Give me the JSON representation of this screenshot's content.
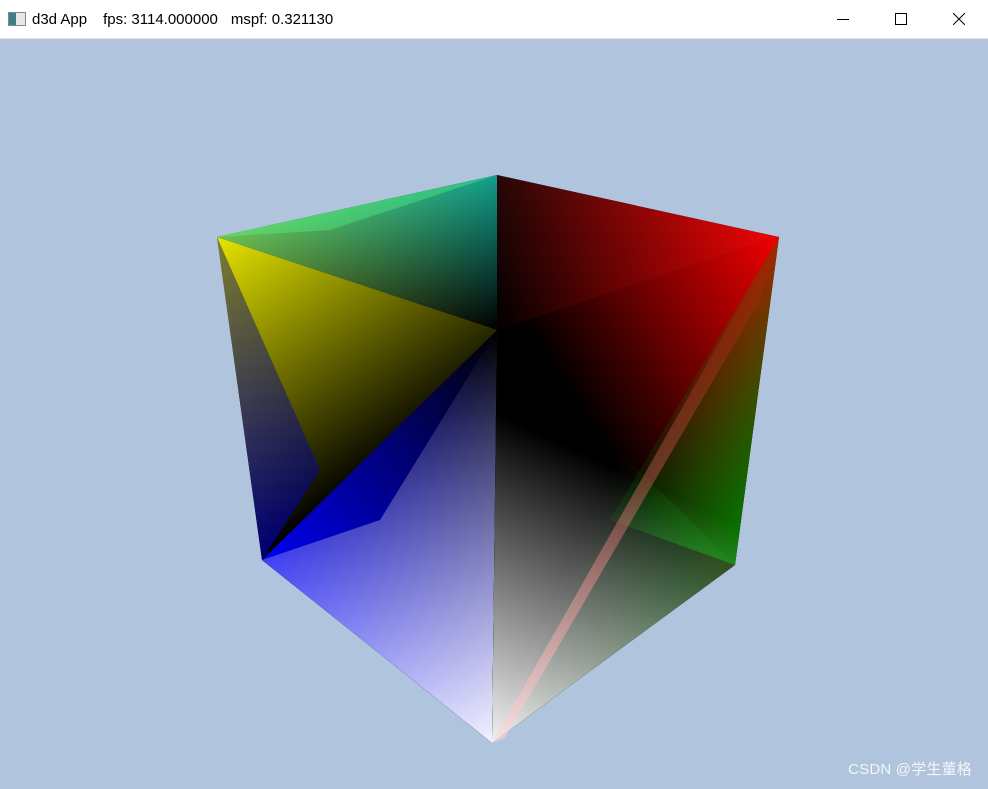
{
  "window": {
    "app_name": "d3d App",
    "fps_text": "fps: 3114.000000",
    "mspf_text": "mspf: 0.321130",
    "controls": {
      "minimize_icon": "minimize-icon",
      "maximize_icon": "maximize-icon",
      "close_icon": "close-icon"
    }
  },
  "scene": {
    "background_color": "#b0c4de",
    "object": "rgb-color-cube",
    "vertex_colors": {
      "top_back": "#00ffff",
      "top_left": "#ffff00",
      "top_right": "#ff0000",
      "center": "#000000",
      "bottom_left": "#0000ff",
      "bottom_right": "#008000",
      "bottom_front": "#ffffff"
    }
  },
  "watermark": {
    "text": "CSDN @学生董格"
  }
}
